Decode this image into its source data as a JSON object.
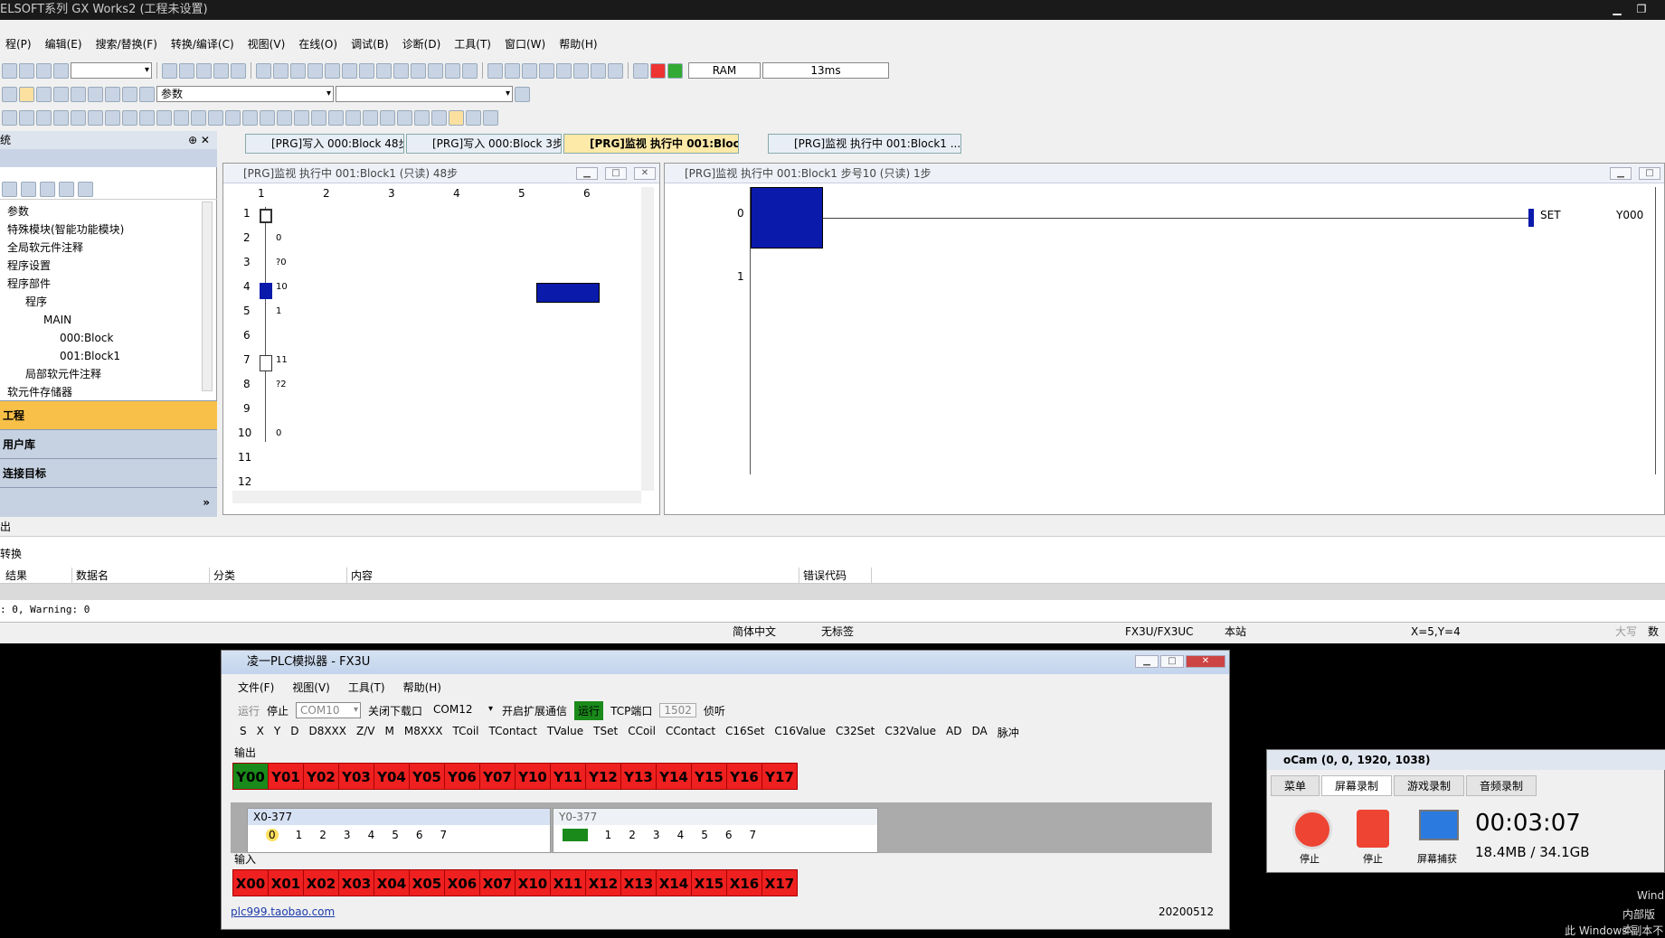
{
  "app": {
    "title": "ELSOFT系列 GX Works2 (工程未设置)"
  },
  "menu": [
    "程(P)",
    "编辑(E)",
    "搜索/替换(F)",
    "转换/编译(C)",
    "视图(V)",
    "在线(O)",
    "调试(B)",
    "诊断(D)",
    "工具(T)",
    "窗口(W)",
    "帮助(H)"
  ],
  "toolbar": {
    "memory": "RAM",
    "scan": "13ms",
    "param_combo": "参数"
  },
  "leftpane": {
    "header": "统",
    "tree": [
      "参数",
      "特殊模块(智能功能模块)",
      "全局软元件注释",
      "程序设置",
      "程序部件",
      "程序",
      "MAIN",
      "000:Block",
      "001:Block1",
      "局部软元件注释",
      "软元件存储器"
    ],
    "nav": [
      "工程",
      "用户库",
      "连接目标"
    ]
  },
  "tabs": [
    "[PRG]写入 000:Block 48步",
    "[PRG]写入 000:Block 3步",
    "[PRG]监视 执行中 001:Bloc...",
    "[PRG]监视 执行中 001:Block1 ..."
  ],
  "sfc": {
    "title": "[PRG]监视 执行中 001:Block1 (只读) 48步",
    "cols": [
      "1",
      "2",
      "3",
      "4",
      "5",
      "6"
    ],
    "rows": [
      "1",
      "2",
      "3",
      "4",
      "5",
      "6",
      "7",
      "8",
      "9",
      "10",
      "11",
      "12"
    ],
    "labels": [
      "?0",
      "0",
      "10",
      "1",
      "11",
      "?2",
      "0"
    ]
  },
  "ladder": {
    "title": "[PRG]监视 执行中 001:Block1 步号10 (只读) 1步",
    "steps": [
      "0",
      "1"
    ],
    "instr": "SET",
    "device": "Y000"
  },
  "output": {
    "header": "出",
    "sub": "转换",
    "cols": [
      "结果",
      "数据名",
      "分类",
      "内容",
      "错误代码"
    ],
    "message": ": 0, Warning: 0"
  },
  "status": {
    "lang": "简体中文",
    "label": "无标签",
    "cpu": "FX3U/FX3UC",
    "station": "本站",
    "pos": "X=5,Y=4",
    "caps": "大写",
    "num": "数字"
  },
  "sim": {
    "title": "凌一PLC模拟器 - FX3U",
    "menu": [
      "文件(F)",
      "视图(V)",
      "工具(T)",
      "帮助(H)"
    ],
    "run": "运行",
    "stop": "停止",
    "com_combo": "COM10",
    "close_port": "关闭下载口",
    "com2": "COM12",
    "ext": "开启扩展通信",
    "running": "运行",
    "tcp": "TCP端口",
    "port": "1502",
    "listen": "侦听",
    "devtabs": [
      "S",
      "X",
      "Y",
      "D",
      "D8XXX",
      "Z/V",
      "M",
      "M8XXX",
      "TCoil",
      "TContact",
      "TValue",
      "TSet",
      "CCoil",
      "CContact",
      "C16Set",
      "C16Value",
      "C32Set",
      "C32Value",
      "AD",
      "DA",
      "脉冲"
    ],
    "out_label": "输出",
    "in_label": "输入",
    "outputs": [
      "Y00",
      "Y01",
      "Y02",
      "Y03",
      "Y04",
      "Y05",
      "Y06",
      "Y07",
      "Y10",
      "Y11",
      "Y12",
      "Y13",
      "Y14",
      "Y15",
      "Y16",
      "Y17"
    ],
    "inputs": [
      "X00",
      "X01",
      "X02",
      "X03",
      "X04",
      "X05",
      "X06",
      "X07",
      "X10",
      "X11",
      "X12",
      "X13",
      "X14",
      "X15",
      "X16",
      "X17"
    ],
    "xwin": "X0-377",
    "ywin": "Y0-377",
    "bits": [
      "0",
      "1",
      "2",
      "3",
      "4",
      "5",
      "6",
      "7"
    ],
    "link": "plc999.taobao.com",
    "date": "20200512"
  },
  "ocam": {
    "title": "oCam (0, 0, 1920, 1038)",
    "tabs": [
      "菜单",
      "屏幕录制",
      "游戏录制",
      "音频录制"
    ],
    "btns": [
      "停止",
      "停止",
      "屏幕捕获"
    ],
    "time": "00:03:07",
    "size": "18.4MB / 34.1GB"
  },
  "desktop": {
    "l1": "Wind",
    "l2": "内部版本",
    "l3": "此 Windows 副本不"
  },
  "colors": {
    "running": "#1a8a1a",
    "off": "#ee2020",
    "monitor_block": "#0a1aaa"
  }
}
